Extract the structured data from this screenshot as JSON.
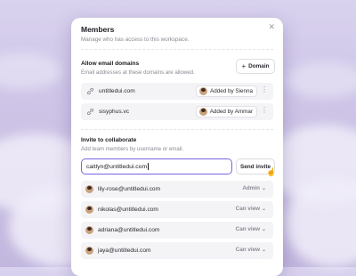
{
  "modal": {
    "title": "Members",
    "subtitle": "Manage who has access to this workspace."
  },
  "domains": {
    "title": "Allow email domains",
    "subtitle": "Email addresses at these domains are allowed.",
    "add_button": "Domain",
    "rows": [
      {
        "domain": "untitledui.com",
        "added_by": "Added by Sienna"
      },
      {
        "domain": "sisyphus.vc",
        "added_by": "Added by Ammar"
      }
    ]
  },
  "invite": {
    "title": "Invite to collaborate",
    "subtitle": "Add team members by username or email.",
    "input_value": "caitlyn@untitledui.com",
    "send_button": "Send invite"
  },
  "members": [
    {
      "email": "lily-rose@untitledui.com",
      "role": "Admin"
    },
    {
      "email": "nikolas@untitledui.com",
      "role": "Can view"
    },
    {
      "email": "adriana@untitledui.com",
      "role": "Can view"
    },
    {
      "email": "jaya@untitledui.com",
      "role": "Can view"
    }
  ],
  "colors": {
    "accent": "#7b63e0",
    "row_bg": "#f4f4f7"
  }
}
